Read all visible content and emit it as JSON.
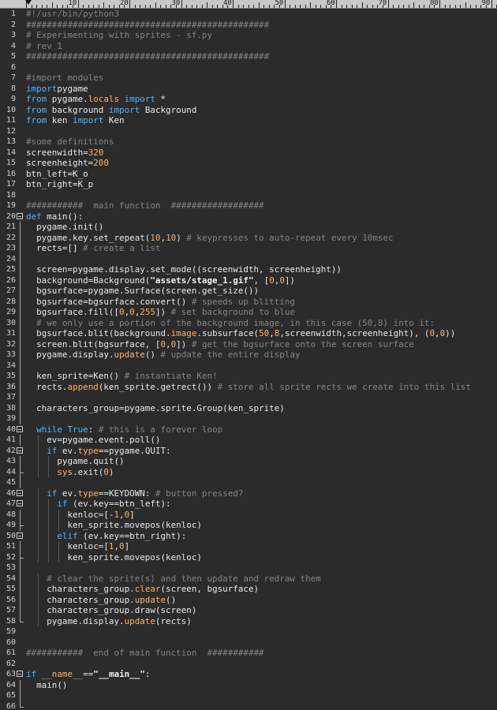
{
  "ruler": {
    "labels": [
      "10",
      "20",
      "30",
      "40",
      "50",
      "60",
      "70",
      "80",
      "90"
    ]
  },
  "colors": {
    "background": "#2b2b2b",
    "comment": "#848484",
    "keyword": "#4fb4ff",
    "number": "#ffb066",
    "default": "#e8e8e8"
  },
  "editor": {
    "lines": [
      {
        "n": "1",
        "t": [
          [
            "cm",
            "#!/usr/bin/python3"
          ]
        ]
      },
      {
        "n": "2",
        "t": [
          [
            "cm",
            "###############################################"
          ]
        ]
      },
      {
        "n": "3",
        "t": [
          [
            "cm",
            "# Experimenting with sprites - sf.py"
          ]
        ]
      },
      {
        "n": "4",
        "t": [
          [
            "cm",
            "# rev 1"
          ]
        ]
      },
      {
        "n": "5",
        "t": [
          [
            "cm",
            "###############################################"
          ]
        ]
      },
      {
        "n": "6",
        "t": []
      },
      {
        "n": "7",
        "t": [
          [
            "cm",
            "#import modules"
          ]
        ]
      },
      {
        "n": "8",
        "t": [
          [
            "kw",
            "import"
          ],
          [
            "",
            "pygame"
          ]
        ]
      },
      {
        "n": "9",
        "t": [
          [
            "kw",
            "from"
          ],
          [
            "",
            " pygame."
          ],
          [
            "at",
            "locals"
          ],
          [
            "",
            " "
          ],
          [
            "kw",
            "import"
          ],
          [
            "",
            " *"
          ]
        ]
      },
      {
        "n": "10",
        "t": [
          [
            "kw",
            "from"
          ],
          [
            "",
            " background "
          ],
          [
            "kw",
            "import"
          ],
          [
            "",
            " Background"
          ]
        ]
      },
      {
        "n": "11",
        "t": [
          [
            "kw",
            "from"
          ],
          [
            "",
            " ken "
          ],
          [
            "kw",
            "import"
          ],
          [
            "",
            " Ken"
          ]
        ]
      },
      {
        "n": "12",
        "t": []
      },
      {
        "n": "13",
        "t": [
          [
            "cm",
            "#some definitions"
          ]
        ]
      },
      {
        "n": "14",
        "t": [
          [
            "",
            "screenwidth="
          ],
          [
            "nm",
            "320"
          ]
        ]
      },
      {
        "n": "15",
        "t": [
          [
            "",
            "screenheight="
          ],
          [
            "nm",
            "200"
          ]
        ]
      },
      {
        "n": "16",
        "t": [
          [
            "",
            "btn_left=K_o"
          ]
        ]
      },
      {
        "n": "17",
        "t": [
          [
            "",
            "btn_right=K_p"
          ]
        ]
      },
      {
        "n": "18",
        "t": []
      },
      {
        "n": "19",
        "t": [
          [
            "cm",
            "###########  main function  ##################"
          ]
        ]
      },
      {
        "n": "20",
        "t": [
          [
            "kw",
            "def"
          ],
          [
            "",
            " main():"
          ]
        ],
        "fold": true
      },
      {
        "n": "21",
        "t": [
          [
            "",
            "  pygame.init()"
          ]
        ]
      },
      {
        "n": "22",
        "t": [
          [
            "",
            "  pygame.key.set_repeat("
          ],
          [
            "nm",
            "10"
          ],
          [
            "",
            ","
          ],
          [
            "nm",
            "10"
          ],
          [
            "",
            ") "
          ],
          [
            "cm",
            "# keypresses to auto-repeat every 10msec"
          ]
        ]
      },
      {
        "n": "23",
        "t": [
          [
            "",
            "  rects=[] "
          ],
          [
            "cm",
            "# create a list"
          ]
        ]
      },
      {
        "n": "24",
        "t": []
      },
      {
        "n": "25",
        "t": [
          [
            "",
            "  screen=pygame.display.set_mode((screenwidth, screenheight))"
          ]
        ]
      },
      {
        "n": "26",
        "t": [
          [
            "",
            "  background=Background("
          ],
          [
            "st",
            "\"assets/stage_1.gif\""
          ],
          [
            "",
            ", ["
          ],
          [
            "nm",
            "0"
          ],
          [
            "",
            ","
          ],
          [
            "nm",
            "0"
          ],
          [
            "",
            "])"
          ]
        ]
      },
      {
        "n": "27",
        "t": [
          [
            "",
            "  bgsurface=pygame.Surface(screen.get_size())"
          ]
        ]
      },
      {
        "n": "28",
        "t": [
          [
            "",
            "  bgsurface=bgsurface.convert() "
          ],
          [
            "cm",
            "# speeds up blitting"
          ]
        ]
      },
      {
        "n": "29",
        "t": [
          [
            "",
            "  bgsurface.fill(["
          ],
          [
            "nm",
            "0"
          ],
          [
            "",
            ","
          ],
          [
            "nm",
            "0"
          ],
          [
            "",
            ","
          ],
          [
            "nm",
            "255"
          ],
          [
            "",
            "]) "
          ],
          [
            "cm",
            "# set background to blue"
          ]
        ]
      },
      {
        "n": "30",
        "t": [
          [
            "cm",
            "  # we only use a portion of the background image, in this case (50,8) into it:"
          ]
        ]
      },
      {
        "n": "31",
        "t": [
          [
            "",
            "  bgsurface.blit(background."
          ],
          [
            "at",
            "image"
          ],
          [
            "",
            ".subsurface("
          ],
          [
            "nm",
            "50"
          ],
          [
            "",
            ","
          ],
          [
            "nm",
            "8"
          ],
          [
            "",
            ",screenwidth,screenheight), ("
          ],
          [
            "nm",
            "0"
          ],
          [
            "",
            ","
          ],
          [
            "nm",
            "0"
          ],
          [
            "",
            "))"
          ]
        ]
      },
      {
        "n": "32",
        "t": [
          [
            "",
            "  screen.blit(bgsurface, ["
          ],
          [
            "nm",
            "0"
          ],
          [
            "",
            ","
          ],
          [
            "nm",
            "0"
          ],
          [
            "",
            "]) "
          ],
          [
            "cm",
            "# get the bgsurface onto the screen surface"
          ]
        ]
      },
      {
        "n": "33",
        "t": [
          [
            "",
            "  pygame.display."
          ],
          [
            "at",
            "update"
          ],
          [
            "",
            "() "
          ],
          [
            "cm",
            "# update the entire display"
          ]
        ]
      },
      {
        "n": "34",
        "t": []
      },
      {
        "n": "35",
        "t": [
          [
            "",
            "  ken_sprite=Ken() "
          ],
          [
            "cm",
            "# instantiate Ken!"
          ]
        ]
      },
      {
        "n": "36",
        "t": [
          [
            "",
            "  rects."
          ],
          [
            "at",
            "append"
          ],
          [
            "",
            "(ken_sprite.getrect()) "
          ],
          [
            "cm",
            "# store all sprite rects we create into this list"
          ]
        ]
      },
      {
        "n": "37",
        "t": []
      },
      {
        "n": "38",
        "t": [
          [
            "",
            "  characters_group=pygame.sprite.Group(ken_sprite)"
          ]
        ]
      },
      {
        "n": "39",
        "t": []
      },
      {
        "n": "40",
        "t": [
          [
            "",
            "  "
          ],
          [
            "kw",
            "while"
          ],
          [
            "",
            " "
          ],
          [
            "kw",
            "True"
          ],
          [
            "",
            ": "
          ],
          [
            "cm",
            "# this is a forever loop"
          ]
        ],
        "fold": true
      },
      {
        "n": "41",
        "t": [
          [
            "",
            "    ev=pygame.event.poll()"
          ]
        ]
      },
      {
        "n": "42",
        "t": [
          [
            "",
            "    "
          ],
          [
            "kw",
            "if"
          ],
          [
            "",
            " ev."
          ],
          [
            "at",
            "type"
          ],
          [
            "",
            "==pygame.QUIT:"
          ]
        ],
        "fold": true
      },
      {
        "n": "43",
        "t": [
          [
            "",
            "      pygame.quit()"
          ]
        ]
      },
      {
        "n": "44",
        "t": [
          [
            "",
            "      "
          ],
          [
            "at",
            "sys"
          ],
          [
            "",
            ".exit("
          ],
          [
            "nm",
            "0"
          ],
          [
            "",
            ")"
          ]
        ],
        "end": true
      },
      {
        "n": "45",
        "t": []
      },
      {
        "n": "46",
        "t": [
          [
            "",
            "    "
          ],
          [
            "kw",
            "if"
          ],
          [
            "",
            " ev."
          ],
          [
            "at",
            "type"
          ],
          [
            "",
            "==KEYDOWN: "
          ],
          [
            "cm",
            "# button pressed?"
          ]
        ],
        "fold": true
      },
      {
        "n": "47",
        "t": [
          [
            "",
            "      "
          ],
          [
            "kw",
            "if"
          ],
          [
            "",
            " (ev.key==btn_left):"
          ]
        ],
        "fold": true
      },
      {
        "n": "48",
        "t": [
          [
            "",
            "        kenloc=[-"
          ],
          [
            "nm",
            "1"
          ],
          [
            "",
            ","
          ],
          [
            "nm",
            "0"
          ],
          [
            "",
            "]"
          ]
        ]
      },
      {
        "n": "49",
        "t": [
          [
            "",
            "        ken_sprite.movepos(kenloc)"
          ]
        ],
        "end": true
      },
      {
        "n": "50",
        "t": [
          [
            "",
            "      "
          ],
          [
            "kw",
            "elif"
          ],
          [
            "",
            " (ev.key==btn_right):"
          ]
        ],
        "fold": true
      },
      {
        "n": "51",
        "t": [
          [
            "",
            "        kenloc=["
          ],
          [
            "nm",
            "1"
          ],
          [
            "",
            ","
          ],
          [
            "nm",
            "0"
          ],
          [
            "",
            "]"
          ]
        ]
      },
      {
        "n": "52",
        "t": [
          [
            "",
            "        ken_sprite.movepos(kenloc)"
          ]
        ],
        "end": true
      },
      {
        "n": "53",
        "t": []
      },
      {
        "n": "54",
        "t": [
          [
            "cm",
            "    # clear the sprite(s) and then update and redraw them"
          ]
        ]
      },
      {
        "n": "55",
        "t": [
          [
            "",
            "    characters_group."
          ],
          [
            "at",
            "clear"
          ],
          [
            "",
            "(screen, bgsurface)"
          ]
        ]
      },
      {
        "n": "56",
        "t": [
          [
            "",
            "    characters_group."
          ],
          [
            "at",
            "update"
          ],
          [
            "",
            "()"
          ]
        ]
      },
      {
        "n": "57",
        "t": [
          [
            "",
            "    characters_group.draw(screen)"
          ]
        ]
      },
      {
        "n": "58",
        "t": [
          [
            "",
            "    pygame.display."
          ],
          [
            "at",
            "update"
          ],
          [
            "",
            "(rects)"
          ]
        ],
        "end": true
      },
      {
        "n": "59",
        "t": []
      },
      {
        "n": "60",
        "t": []
      },
      {
        "n": "61",
        "t": [
          [
            "cm",
            "###########  end of main function  ###########"
          ]
        ]
      },
      {
        "n": "62",
        "t": []
      },
      {
        "n": "63",
        "t": [
          [
            "kw",
            "if"
          ],
          [
            "",
            " "
          ],
          [
            "at",
            "__name__"
          ],
          [
            "",
            "=="
          ],
          [
            "st",
            "\"__main__\""
          ],
          [
            "",
            ":"
          ]
        ],
        "fold": true
      },
      {
        "n": "64",
        "t": [
          [
            "",
            "  main()"
          ]
        ]
      },
      {
        "n": "65",
        "t": []
      },
      {
        "n": "66",
        "t": []
      }
    ]
  }
}
